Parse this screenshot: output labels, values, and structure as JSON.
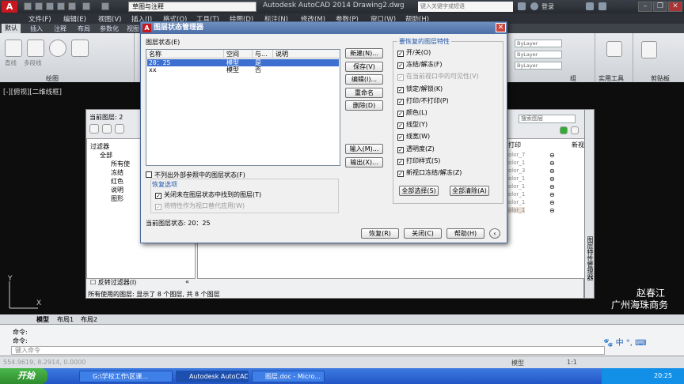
{
  "app": {
    "workspace": "草图与注释",
    "title": "Autodesk AutoCAD 2014    Drawing2.dwg",
    "search_placeholder": "键入关键字或短语",
    "login": "登录"
  },
  "menu": [
    "文件(F)",
    "编辑(E)",
    "视图(V)",
    "插入(I)",
    "格式(O)",
    "工具(T)",
    "绘图(D)",
    "标注(N)",
    "修改(M)",
    "参数(P)",
    "窗口(W)",
    "帮助(H)"
  ],
  "ribbon_tabs": [
    "默认",
    "插入",
    "注释",
    "布局",
    "参数化",
    "视图",
    "管理",
    "输出"
  ],
  "ribbon": {
    "draw_items": [
      "直线",
      "多段线"
    ],
    "draw_panel": "绘图",
    "group_label": "组",
    "util_label": "实用工具",
    "clip_label": "剪贴板",
    "bylayer": "ByLayer"
  },
  "viewport_label": "[-][俯视][二维线框]",
  "layer_manager": {
    "current_layer": "当前图层: 2",
    "search_placeholder": "搜索图层",
    "tree": [
      "过滤器",
      "全部",
      "所有使",
      "冻结",
      "红色",
      "说明",
      "图形"
    ],
    "invert_filter": "反转过滤器(I)",
    "collapse": "«",
    "columns": [
      "打印",
      "新视"
    ],
    "colors": [
      "olor_7",
      "olor_1",
      "olor_3",
      "olor_1",
      "olor_1",
      "olor_1",
      "olor_1",
      "olor_1"
    ],
    "status": "所有使用的图层: 显示了 8 个图层, 共 8 个图层",
    "side_title": "图层特性管理器"
  },
  "watermark": [
    "赵春江",
    "广州海珠商务"
  ],
  "layout_tabs": [
    "模型",
    "布局1",
    "布局2"
  ],
  "command": {
    "line1": "命令:",
    "line2": "命令:",
    "placeholder": "键入命令"
  },
  "statusbar": {
    "coords": "554.9619, 8.2914, 0.0000",
    "model": "模型",
    "scale": "1:1"
  },
  "taskbar": {
    "start": "开始",
    "tasks": [
      "G:\\学校工作\\区课...",
      "Autodesk AutoCAD...",
      "图层.doc - Micro..."
    ],
    "clock": "20:25"
  },
  "dialog": {
    "title": "图层状态管理器",
    "states_label": "图层状态(E)",
    "columns": [
      "名称",
      "空间",
      "与...",
      "说明"
    ],
    "rows": [
      {
        "name": "20：25",
        "space": "模型",
        "match": "是",
        "desc": ""
      },
      {
        "name": "xx",
        "space": "模型",
        "match": "否",
        "desc": ""
      }
    ],
    "buttons": {
      "new": "新建(N)...",
      "save": "保存(V)",
      "edit": "编辑(I)...",
      "rename": "重命名",
      "delete": "删除(D)",
      "import": "输入(M)...",
      "export": "输出(X)...",
      "restore": "恢复(R)",
      "close": "关闭(C)",
      "help": "帮助(H)"
    },
    "no_xref": "不列出外部参照中的图层状态(F)",
    "restore_options": "恢复选项",
    "turn_off": "关闭未在图层状态中找到的图层(T)",
    "apply_viewport": "将特性作为视口替代应用(W)",
    "current_state": "当前图层状态: 20：25",
    "props_group": "要恢复的图层特性",
    "props": [
      {
        "label": "开/关(O)",
        "checked": true,
        "disabled": false
      },
      {
        "label": "冻结/解冻(F)",
        "checked": true,
        "disabled": false
      },
      {
        "label": "在当前视口中的可见性(V)",
        "checked": true,
        "disabled": true
      },
      {
        "label": "锁定/解锁(K)",
        "checked": true,
        "disabled": false
      },
      {
        "label": "打印/不打印(P)",
        "checked": true,
        "disabled": false
      },
      {
        "label": "颜色(L)",
        "checked": true,
        "disabled": false
      },
      {
        "label": "线型(Y)",
        "checked": true,
        "disabled": false
      },
      {
        "label": "线宽(W)",
        "checked": true,
        "disabled": false
      },
      {
        "label": "透明度(Z)",
        "checked": true,
        "disabled": false
      },
      {
        "label": "打印样式(S)",
        "checked": true,
        "disabled": false
      },
      {
        "label": "新视口冻结/解冻(Z)",
        "checked": true,
        "disabled": false
      }
    ],
    "select_all": "全部选择(S)",
    "clear_all": "全部清除(A)"
  }
}
